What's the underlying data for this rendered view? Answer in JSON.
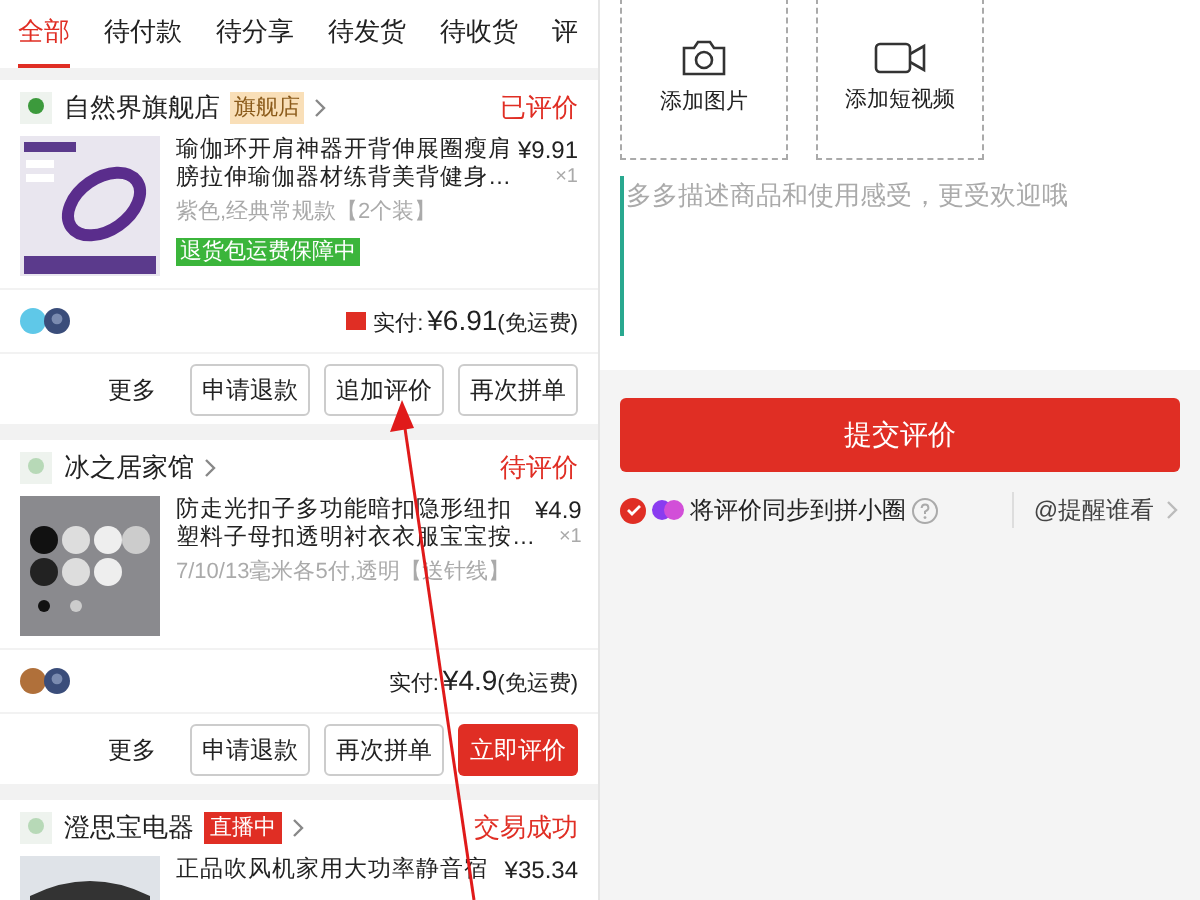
{
  "tabs": [
    {
      "label": "全部",
      "selected": true
    },
    {
      "label": "待付款",
      "selected": false
    },
    {
      "label": "待分享",
      "selected": false
    },
    {
      "label": "待发货",
      "selected": false
    },
    {
      "label": "待收货",
      "selected": false
    },
    {
      "label": "评",
      "selected": false
    }
  ],
  "orders": [
    {
      "shop": {
        "name": "自然界旗舰店",
        "badge": {
          "kind": "flagship",
          "text": "旗舰店"
        }
      },
      "status": "已评价",
      "product": {
        "title_lines": [
          "瑜伽环开肩神器开背伸展圈瘦肩",
          "膀拉伸瑜伽器材练背美背健身…"
        ],
        "price": "¥9.91",
        "qty": "×1",
        "spec": "紫色,经典常规款【2个装】",
        "tag": "退货包运费保障中"
      },
      "coupon": true,
      "paid_label": "实付:",
      "paid": "¥6.91",
      "shipping": "(免运费)",
      "buttons": [
        {
          "label": "更多",
          "kind": "text"
        },
        {
          "label": "申请退款",
          "kind": "outline"
        },
        {
          "label": "追加评价",
          "kind": "outline"
        },
        {
          "label": "再次拼单",
          "kind": "outline"
        }
      ]
    },
    {
      "shop": {
        "name": "冰之居家馆"
      },
      "status": "待评价",
      "product": {
        "title_lines": [
          "防走光扣子多功能暗扣隐形纽扣",
          "塑料子母扣透明衬衣衣服宝宝按…"
        ],
        "price": "¥4.9",
        "qty": "×1",
        "spec": "7/10/13毫米各5付,透明【送针线】"
      },
      "coupon": false,
      "paid_label": "实付:",
      "paid": "¥4.9",
      "shipping": "(免运费)",
      "buttons": [
        {
          "label": "更多",
          "kind": "text"
        },
        {
          "label": "申请退款",
          "kind": "outline"
        },
        {
          "label": "再次拼单",
          "kind": "outline"
        },
        {
          "label": "立即评价",
          "kind": "primary"
        }
      ]
    },
    {
      "shop": {
        "name": "澄思宝电器",
        "badge": {
          "kind": "live",
          "text": "直播中"
        }
      },
      "status": "交易成功",
      "product": {
        "title_lines": [
          "正品吹风机家用大功率静音宿"
        ],
        "price": "¥35.34"
      }
    }
  ],
  "review": {
    "uploads": [
      {
        "label": "添加图片"
      },
      {
        "label": "添加短视频"
      }
    ],
    "placeholder": "多多描述商品和使用感受，更受欢迎哦",
    "submit": "提交评价",
    "sync": {
      "checked": true,
      "text": "将评价同步到拼小圈"
    },
    "mention": "@提醒谁看"
  }
}
